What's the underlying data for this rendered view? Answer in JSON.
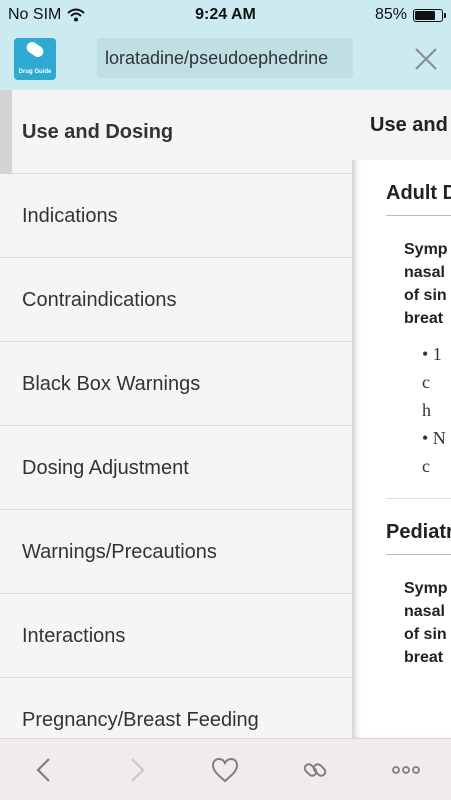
{
  "status_bar": {
    "carrier": "No SIM",
    "time": "9:24 AM",
    "battery": "85%",
    "battery_level": 0.85
  },
  "header": {
    "app_icon_label": "Drug Guide",
    "drug_name": "loratadine/pseudoephedrine"
  },
  "menu": {
    "items": [
      {
        "label": "Use and Dosing",
        "active": true
      },
      {
        "label": "Indications"
      },
      {
        "label": "Contraindications"
      },
      {
        "label": "Black Box Warnings"
      },
      {
        "label": "Dosing Adjustment"
      },
      {
        "label": "Warnings/Precautions"
      },
      {
        "label": "Interactions"
      },
      {
        "label": "Pregnancy/Breast Feeding"
      }
    ]
  },
  "content": {
    "header": "Use and",
    "sections": [
      {
        "title": "Adult D",
        "para_lines": [
          "Symp",
          "nasal",
          "of sin",
          "breat"
        ],
        "bullets": [
          "• 1",
          "  c",
          "  h",
          "• N",
          "  c"
        ]
      },
      {
        "title": "Pediatr",
        "para_lines": [
          "Symp",
          "nasal",
          "of sin",
          "breat"
        ]
      }
    ]
  },
  "toolbar": {
    "icons": [
      "back-icon",
      "forward-icon",
      "heart-icon",
      "link-icon",
      "more-icon"
    ]
  }
}
